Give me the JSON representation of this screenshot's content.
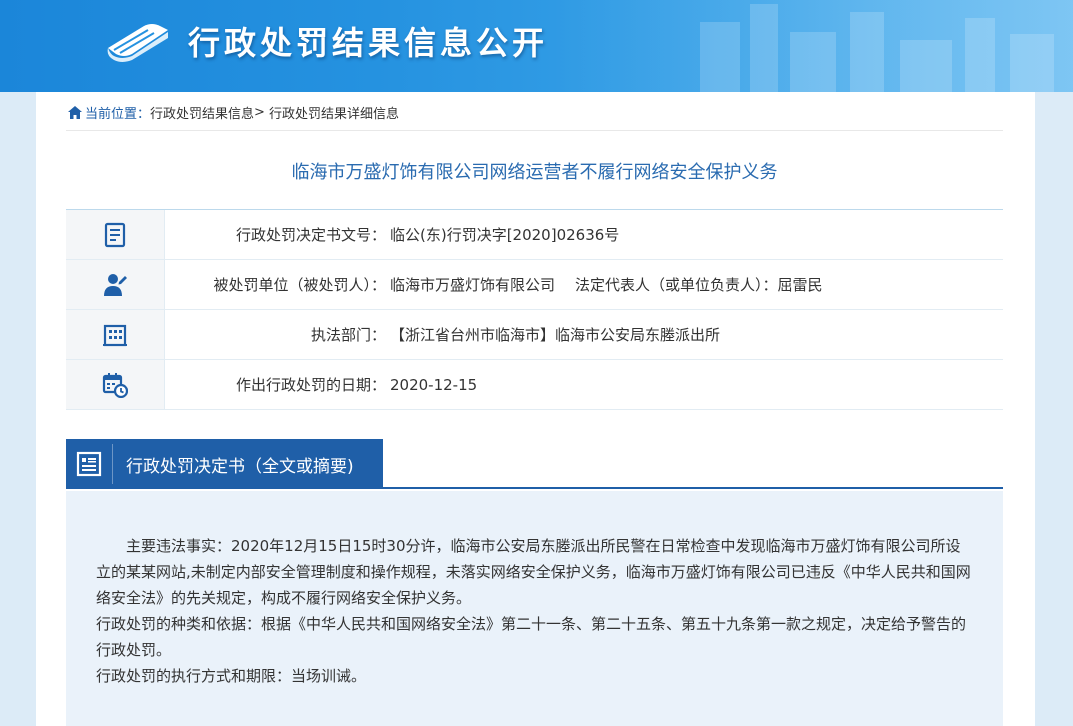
{
  "banner": {
    "title": "行政处罚结果信息公开",
    "icon": "book-stack-icon"
  },
  "breadcrumb": {
    "icon": "home-icon",
    "current_label": "当前位置：",
    "items": [
      "行政处罚结果信息",
      "行政处罚结果详细信息"
    ],
    "separator": ">"
  },
  "page_title": "临海市万盛灯饰有限公司网络运营者不履行网络安全保护义务",
  "info_rows": [
    {
      "icon": "document-icon",
      "label": "行政处罚决定书文号：",
      "value": "临公(东)行罚决字[2020]02636号"
    },
    {
      "icon": "person-icon",
      "label": "被处罚单位（被处罚人）：",
      "value": "临海市万盛灯饰有限公司",
      "extra_label": "法定代表人（或单位负责人）：",
      "extra_value": "屈雷民"
    },
    {
      "icon": "building-icon",
      "label": "执法部门：",
      "value": "【浙江省台州市临海市】临海市公安局东塍派出所"
    },
    {
      "icon": "calendar-clock-icon",
      "label": "作出行政处罚的日期：",
      "value": "2020-12-15"
    }
  ],
  "decision": {
    "icon": "document-list-icon",
    "heading": "行政处罚决定书（全文或摘要)",
    "paragraphs": [
      "主要违法事实：2020年12月15日15时30分许，临海市公安局东塍派出所民警在日常检查中发现临海市万盛灯饰有限公司所设立的某某网站,未制定内部安全管理制度和操作规程，未落实网络安全保护义务，临海市万盛灯饰有限公司已违反《中华人民共和国网络安全法》的先关规定，构成不履行网络安全保护义务。",
      "行政处罚的种类和依据：根据《中华人民共和国网络安全法》第二十一条、第二十五条、第五十九条第一款之规定，决定给予警告的行政处罚。",
      "行政处罚的执行方式和期限：当场训诫。"
    ]
  },
  "colors": {
    "banner": "#2592e0",
    "accent": "#1f5fa8",
    "title": "#2a6bb0",
    "section_bg": "#eaf2fa"
  }
}
